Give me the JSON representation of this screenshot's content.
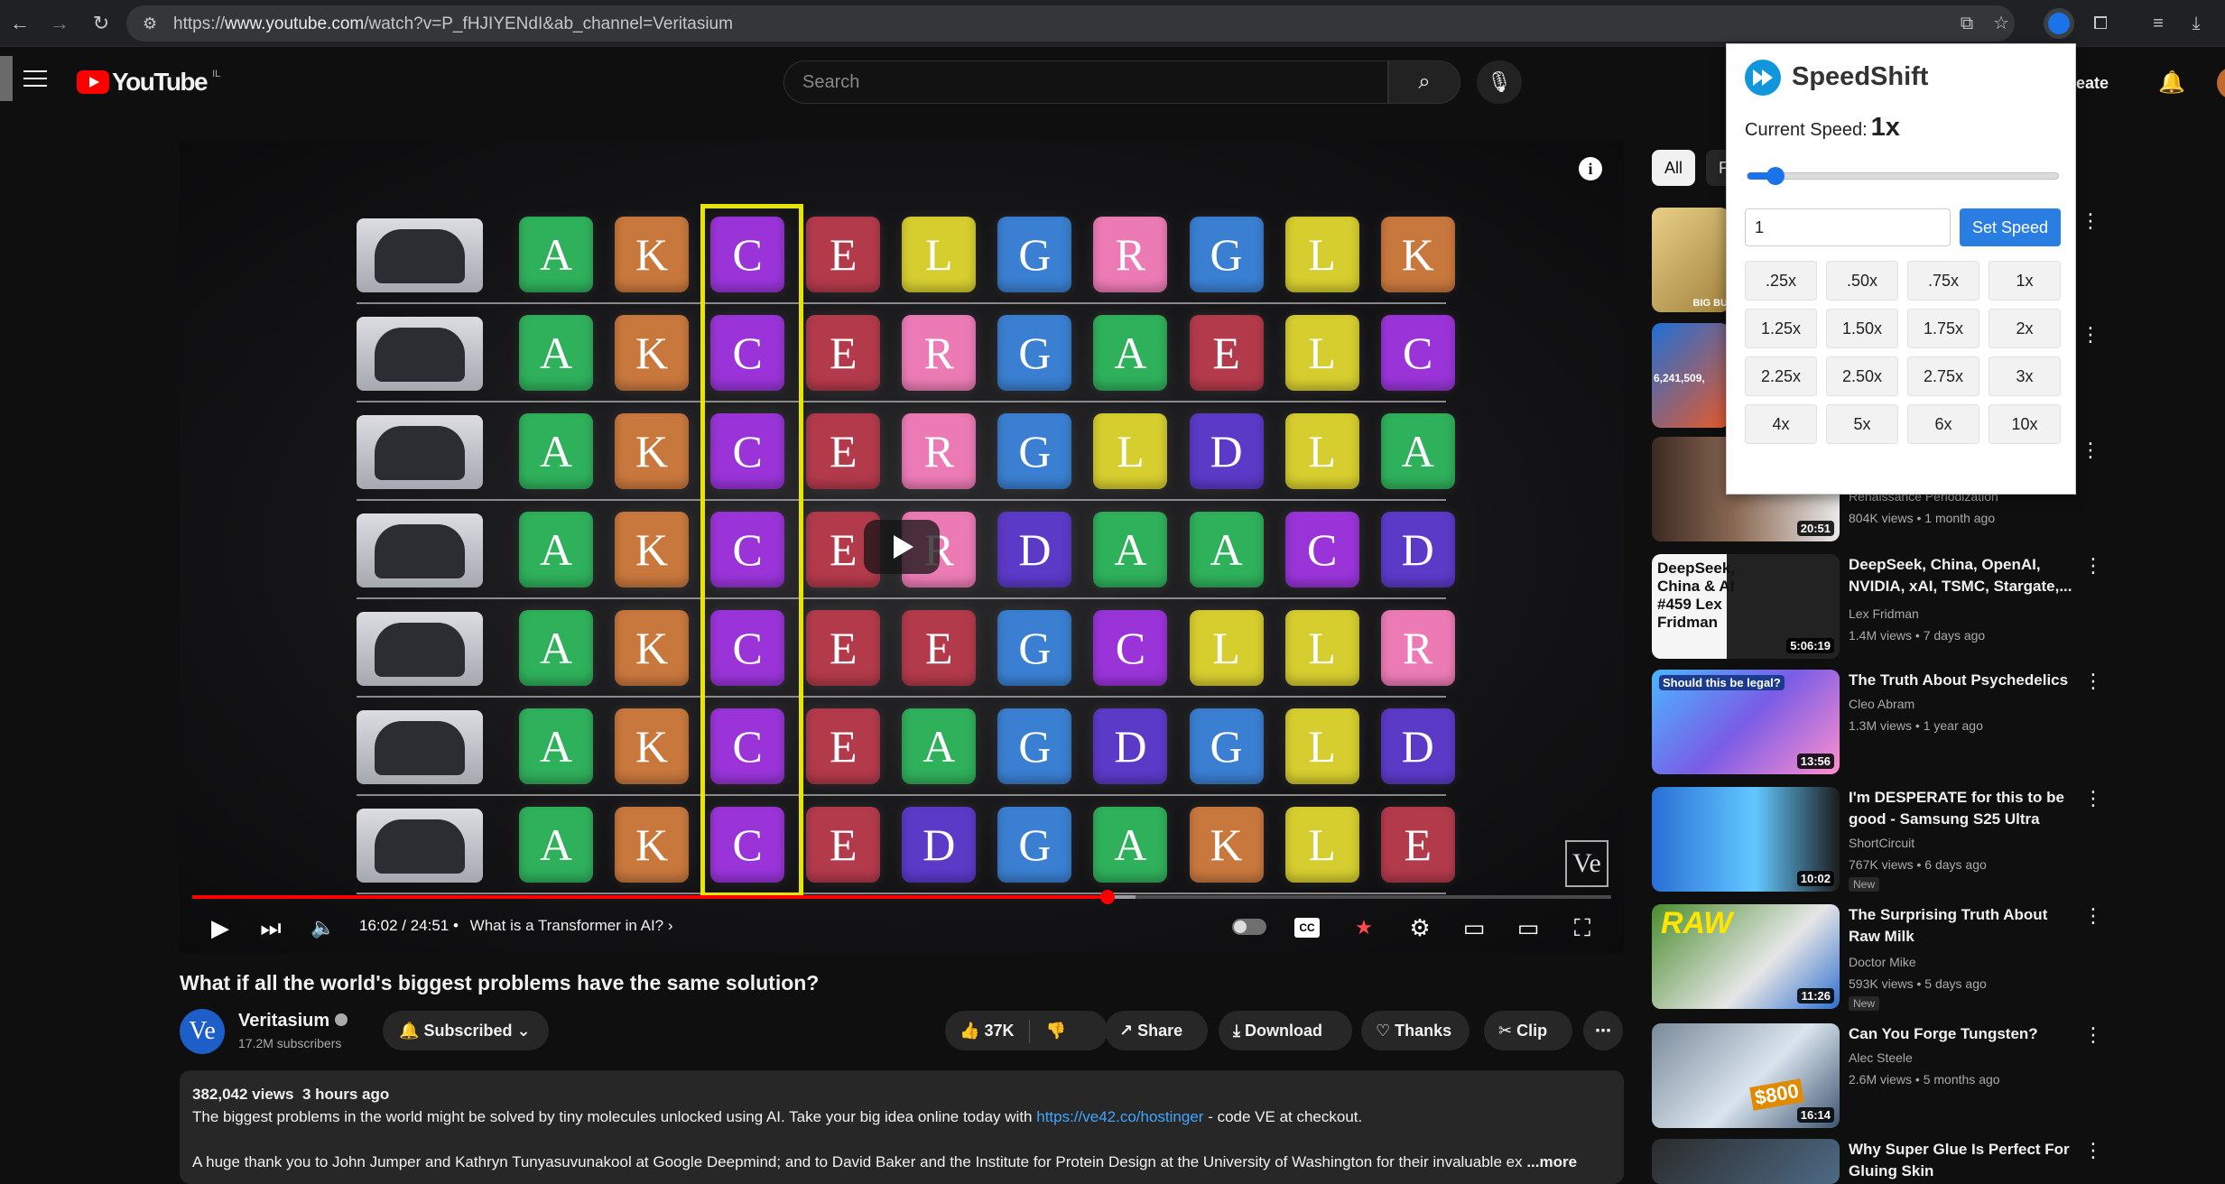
{
  "browser": {
    "url_prefix": "https://",
    "url_domain": "www.youtube.com",
    "url_path": "/watch?v=P_fHJIYENdI&ab_channel=Veritasium"
  },
  "header": {
    "logo_text": "YouTube",
    "country": "IL",
    "search_placeholder": "Search",
    "create_label": "Create"
  },
  "video": {
    "time": "16:02 / 24:51",
    "chapter": "What is a Transformer in AI?",
    "progress": 0.645,
    "buffered": 0.665,
    "watermark": "Ve",
    "info_icon": "i",
    "grid": [
      [
        "A",
        "K",
        "C",
        "E",
        "L",
        "G",
        "R",
        "G",
        "L",
        "K"
      ],
      [
        "A",
        "K",
        "C",
        "E",
        "R",
        "G",
        "A",
        "E",
        "L",
        "C"
      ],
      [
        "A",
        "K",
        "C",
        "E",
        "R",
        "G",
        "L",
        "D",
        "L",
        "A"
      ],
      [
        "A",
        "K",
        "C",
        "E",
        "R",
        "D",
        "A",
        "A",
        "C",
        "D"
      ],
      [
        "A",
        "K",
        "C",
        "E",
        "E",
        "G",
        "C",
        "L",
        "L",
        "R"
      ],
      [
        "A",
        "K",
        "C",
        "E",
        "A",
        "G",
        "D",
        "G",
        "L",
        "D"
      ],
      [
        "A",
        "K",
        "C",
        "E",
        "D",
        "G",
        "A",
        "K",
        "L",
        "E"
      ]
    ],
    "letter_colors": {
      "A": "#2fb05b",
      "K": "#c9783d",
      "C": "#9a34d9",
      "E": "#b33a4b",
      "L": "#d6cd2f",
      "G": "#3a7fd1",
      "R": "#ec7bb5",
      "D": "#5b3ac8"
    },
    "animal_icons": [
      "person-icon",
      "cat-icon",
      "dog-icon",
      "elephant-icon",
      "horse-icon",
      "cow-icon",
      "monkey-icon"
    ]
  },
  "watch": {
    "title": "What if all the world's biggest problems have the same solution?",
    "channel_avatar": "Ve",
    "channel": "Veritasium",
    "subscribers": "17.2M subscribers",
    "subscribed_label": "Subscribed",
    "likes": "37K",
    "share_label": "Share",
    "download_label": "Download",
    "thanks_label": "Thanks",
    "clip_label": "Clip",
    "views": "382,042 views",
    "posted": "3 hours ago",
    "desc_line1_a": "The biggest problems in the world might be solved by tiny molecules unlocked using AI. Take your big idea online today with",
    "desc_link": "https://ve42.co/hostinger",
    "desc_line1_b": "- code VE at checkout.",
    "desc_line2": "A huge thank you to John Jumper and Kathryn Tunyasuvunakool at Google Deepmind; and to David Baker and the Institute for Protein Design at the University of Washington for their invaluable ex",
    "more_label": "...more"
  },
  "sidebar": {
    "chip_all": "All",
    "chip_next": "F",
    "recs": [
      {
        "title": "",
        "channel": "Renaissance Periodization",
        "views": "804K views",
        "age": "1 month ago",
        "duration": "20:51"
      },
      {
        "title": "DeepSeek, China, OpenAI, NVIDIA, xAI, TSMC, Stargate,...",
        "channel": "Lex Fridman",
        "views": "1.4M views",
        "age": "7 days ago",
        "duration": "5:06:19"
      },
      {
        "title": "The Truth About Psychedelics",
        "channel": "Cleo Abram",
        "views": "1.3M views",
        "age": "1 year ago",
        "duration": "13:56"
      },
      {
        "title": "I'm DESPERATE for this to be good - Samsung S25 Ultra",
        "channel": "ShortCircuit",
        "views": "767K views",
        "age": "6 days ago",
        "duration": "10:02",
        "badge": "New"
      },
      {
        "title": "The Surprising Truth About Raw Milk",
        "channel": "Doctor Mike",
        "views": "593K views",
        "age": "5 days ago",
        "duration": "11:26",
        "badge": "New"
      },
      {
        "title": "Can You Forge Tungsten?",
        "channel": "Alec Steele",
        "views": "2.6M views",
        "age": "5 months ago",
        "duration": "16:14"
      },
      {
        "title": "Why Super Glue Is Perfect For Gluing Skin",
        "channel": "",
        "views": "",
        "age": "",
        "duration": ""
      }
    ],
    "thumb_texts": {
      "t1": "BIG BU",
      "t2": "6,241,509,",
      "t3": "DeepSeek, China & AI #459 Lex Fridman",
      "t4": "Should this be legal?",
      "t5": "RAW",
      "t6": "$800"
    }
  },
  "speedshift": {
    "title": "SpeedShift",
    "current_label": "Current Speed:",
    "current_value": "1x",
    "slider_fraction": 0.09,
    "input_value": "1",
    "set_label": "Set Speed",
    "presets": [
      ".25x",
      ".50x",
      ".75x",
      "1x",
      "1.25x",
      "1.50x",
      "1.75x",
      "2x",
      "2.25x",
      "2.50x",
      "2.75x",
      "3x",
      "4x",
      "5x",
      "6x",
      "10x"
    ]
  }
}
